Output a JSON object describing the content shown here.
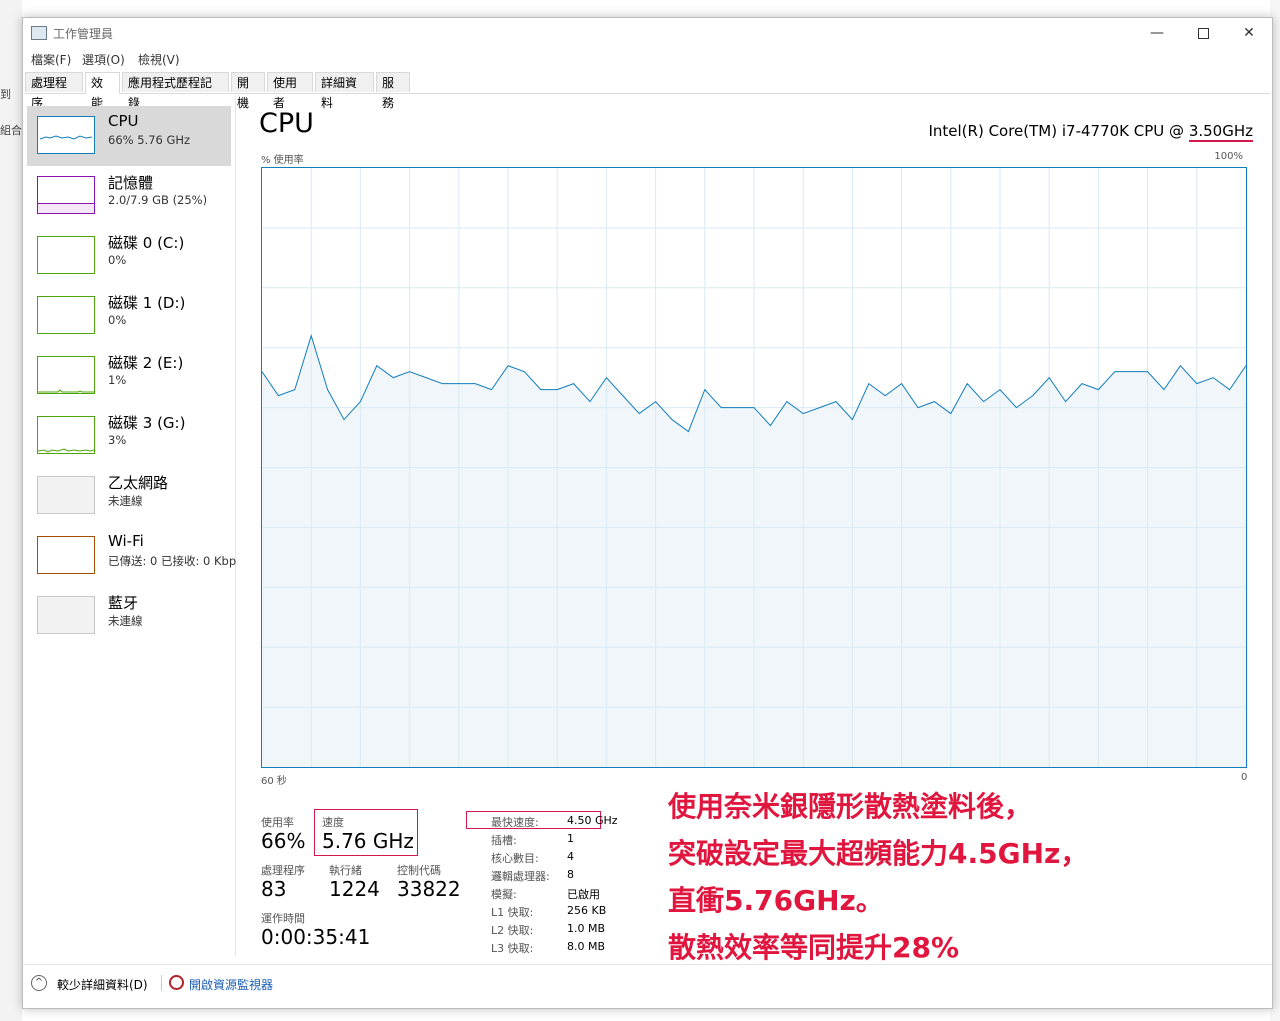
{
  "background": {
    "items": [
      "到",
      "組合"
    ]
  },
  "window": {
    "title": "工作管理員",
    "minimize_glyph": "—",
    "close_glyph": "✕"
  },
  "menu": [
    "檔案(F)",
    "選項(O)",
    "檢視(V)"
  ],
  "tabs": [
    {
      "label": "處理程序",
      "active": false
    },
    {
      "label": "效能",
      "active": true
    },
    {
      "label": "應用程式歷程記錄",
      "active": false
    },
    {
      "label": "開機",
      "active": false
    },
    {
      "label": "使用者",
      "active": false
    },
    {
      "label": "詳細資料",
      "active": false
    },
    {
      "label": "服務",
      "active": false
    }
  ],
  "sidebar": {
    "items": [
      {
        "name": "CPU",
        "value": "66%  5.76 GHz",
        "color": "#117dbb",
        "selected": true
      },
      {
        "name": "記憶體",
        "value": "2.0/7.9 GB (25%)",
        "color": "#8b12ae",
        "selected": false
      },
      {
        "name": "磁碟 0 (C:)",
        "value": "0%",
        "color": "#4da60c",
        "selected": false
      },
      {
        "name": "磁碟 1 (D:)",
        "value": "0%",
        "color": "#4da60c",
        "selected": false
      },
      {
        "name": "磁碟 2 (E:)",
        "value": "1%",
        "color": "#4da60c",
        "selected": false
      },
      {
        "name": "磁碟 3 (G:)",
        "value": "3%",
        "color": "#4da60c",
        "selected": false
      },
      {
        "name": "乙太網路",
        "value": "未連線",
        "color": "#c8c8c8",
        "selected": false
      },
      {
        "name": "Wi-Fi",
        "value": "已傳送: 0 已接收: 0 Kbp",
        "color": "#a74f01",
        "selected": false
      },
      {
        "name": "藍牙",
        "value": "未連線",
        "color": "#c8c8c8",
        "selected": false
      }
    ]
  },
  "main": {
    "title": "CPU",
    "model_prefix": "Intel(R) Core(TM) i7-4770K CPU @ ",
    "model_speed": "3.50GHz",
    "usage_label": "% 使用率",
    "usage_max": "100%",
    "time_left": "60 秒",
    "time_right": "0",
    "line_color": "#117dbb",
    "fill_color": "#f1f6fa",
    "usage_history": [
      66,
      62,
      63,
      72,
      63,
      58,
      61,
      67,
      65,
      66,
      65,
      64,
      64,
      64,
      63,
      67,
      66,
      63,
      63,
      64,
      61,
      65,
      62,
      59,
      61,
      58,
      56,
      63,
      60,
      60,
      60,
      57,
      61,
      59,
      60,
      61,
      58,
      64,
      62,
      64,
      60,
      61,
      59,
      64,
      61,
      63,
      60,
      62,
      65,
      61,
      64,
      63,
      66,
      66,
      66,
      63,
      67,
      64,
      65,
      63,
      67
    ]
  },
  "stats": {
    "utilization_label": "使用率",
    "utilization": "66%",
    "speed_label": "速度",
    "speed": "5.76 GHz",
    "processes_label": "處理程序",
    "processes": "83",
    "threads_label": "執行緒",
    "threads": "1224",
    "handles_label": "控制代碼",
    "handles": "33822",
    "uptime_label": "運作時間",
    "uptime": "0:00:35:41"
  },
  "details": [
    {
      "key": "最快速度:",
      "value": "4.50 GHz"
    },
    {
      "key": "插槽:",
      "value": "1"
    },
    {
      "key": "核心數目:",
      "value": "4"
    },
    {
      "key": "邏輯處理器:",
      "value": "8"
    },
    {
      "key": "模擬:",
      "value": "已啟用"
    },
    {
      "key": "L1 快取:",
      "value": "256 KB"
    },
    {
      "key": "L2 快取:",
      "value": "1.0 MB"
    },
    {
      "key": "L3 快取:",
      "value": "8.0 MB"
    }
  ],
  "annotation": {
    "lines": [
      "使用奈米銀隱形散熱塗料後，",
      "突破設定最大超頻能力4.5GHz，",
      "直衝5.76GHz。",
      "散熱效率等同提升28%"
    ],
    "color": "#e0163f"
  },
  "footer": {
    "fewer_details": "較少詳細資料(D)",
    "resource_monitor": "開啟資源監視器"
  }
}
